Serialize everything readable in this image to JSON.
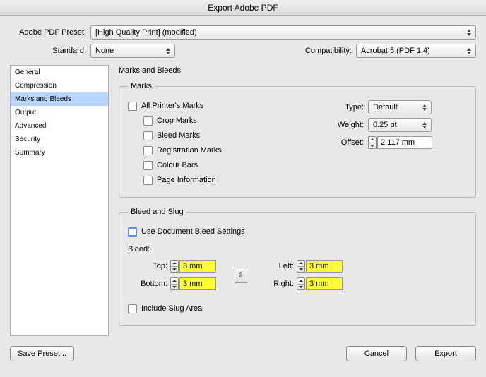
{
  "title": "Export Adobe PDF",
  "preset": {
    "label": "Adobe PDF Preset:",
    "value": "[High Quality Print] (modified)"
  },
  "standard": {
    "label": "Standard:",
    "value": "None"
  },
  "compatibility": {
    "label": "Compatibility:",
    "value": "Acrobat 5 (PDF 1.4)"
  },
  "sidebar": {
    "items": [
      {
        "label": "General"
      },
      {
        "label": "Compression"
      },
      {
        "label": "Marks and Bleeds"
      },
      {
        "label": "Output"
      },
      {
        "label": "Advanced"
      },
      {
        "label": "Security"
      },
      {
        "label": "Summary"
      }
    ],
    "selected_index": 2
  },
  "section_title": "Marks and Bleeds",
  "marks_group": {
    "legend": "Marks",
    "all": "All Printer's Marks",
    "crop": "Crop Marks",
    "bleed": "Bleed Marks",
    "reg": "Registration Marks",
    "colour": "Colour Bars",
    "page": "Page Information",
    "type_label": "Type:",
    "type_value": "Default",
    "weight_label": "Weight:",
    "weight_value": "0.25 pt",
    "offset_label": "Offset:",
    "offset_value": "2.117 mm"
  },
  "bleed_group": {
    "legend": "Bleed and Slug",
    "use_doc": "Use Document Bleed Settings",
    "bleed_label": "Bleed:",
    "top": {
      "label": "Top:",
      "value": "3 mm"
    },
    "bottom": {
      "label": "Bottom:",
      "value": "3 mm"
    },
    "left": {
      "label": "Left:",
      "value": "3 mm"
    },
    "right": {
      "label": "Right:",
      "value": "3 mm"
    },
    "include_slug": "Include Slug Area"
  },
  "buttons": {
    "save": "Save Preset...",
    "cancel": "Cancel",
    "export": "Export"
  }
}
